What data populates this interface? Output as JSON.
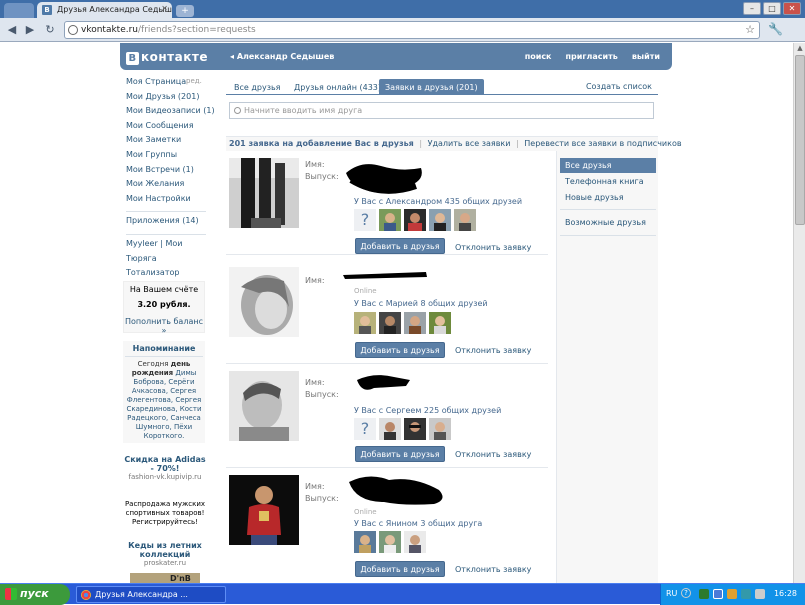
{
  "browser": {
    "tab_title": "Друзья Александра Седыш",
    "url_host": "vkontakte.ru",
    "url_path": "/friends?section=requests"
  },
  "header": {
    "logo": "контакте",
    "logo_letter": "В",
    "back_label": "Александр Седышев",
    "links": [
      "поиск",
      "пригласить",
      "выйти"
    ]
  },
  "leftmenu": {
    "edit": "ред.",
    "items": [
      "Моя Страница",
      "Мои Друзья (201)",
      "Мои Видеозаписи (1)",
      "Мои Сообщения",
      "Мои Заметки",
      "Мои Группы",
      "Мои Встречи (1)",
      "Мои Желания",
      "Мои Настройки"
    ],
    "apps": [
      "Приложения (14)"
    ],
    "extra": [
      "Myyleer | Мои",
      "Тюряга",
      "Тотализатор"
    ]
  },
  "balance": {
    "label": "На Вашем счёте",
    "amount": "3.20 рубля.",
    "topup": "Пополнить баланс »"
  },
  "reminder": {
    "title": "Напоминание",
    "text_1": "Сегодня",
    "text_2": "день рождения",
    "names": "Димы Боброва, Серёги Ачкасова, Сергея Флегентова, Сергея Скарединова, Кости Радецкого, Санчеса Шумного, Пёхи Короткого."
  },
  "ads": [
    {
      "title": "Скидка на Adidas - 70%!",
      "url": "fashion-vk.kupivip.ru"
    },
    {
      "text": "Распродажа мужских спортивных товаров! Регистрируйтесь!"
    },
    {
      "title": "Кеды из летних коллекций",
      "url": "proskater.ru",
      "img_text": "D'nB"
    }
  ],
  "tabs": [
    "Все друзья",
    "Друзья онлайн (433)",
    "Заявки в друзья (201)"
  ],
  "create_list": "Создать список",
  "search": {
    "placeholder": "Начните вводить имя друга"
  },
  "requests_bar": {
    "count": "201 заявка на добавление Вас в друзья",
    "delete_all": "Удалить все заявки",
    "sep": "|",
    "move_all": "Перевести все заявки в подписчиков"
  },
  "filters": [
    "Все друзья",
    "Телефонная книга",
    "Новые друзья",
    "Возможные друзья"
  ],
  "labels": {
    "name": "Имя:",
    "graduation": "Выпуск:",
    "online": "Online",
    "add": "Добавить в друзья",
    "decline": "Отклонить заявку"
  },
  "requests": [
    {
      "mutual": "У Вас с Александром 435 общих друзей"
    },
    {
      "mutual": "У Вас с Марией 8 общих друзей"
    },
    {
      "mutual": "У Вас с Сергеем 225 общих друзей"
    },
    {
      "mutual": "У Вас с Янином 3 общих друга"
    }
  ],
  "taskbar": {
    "start": "пуск",
    "task": "Друзья Александра ...",
    "lang": "RU",
    "clock": "16:28"
  }
}
